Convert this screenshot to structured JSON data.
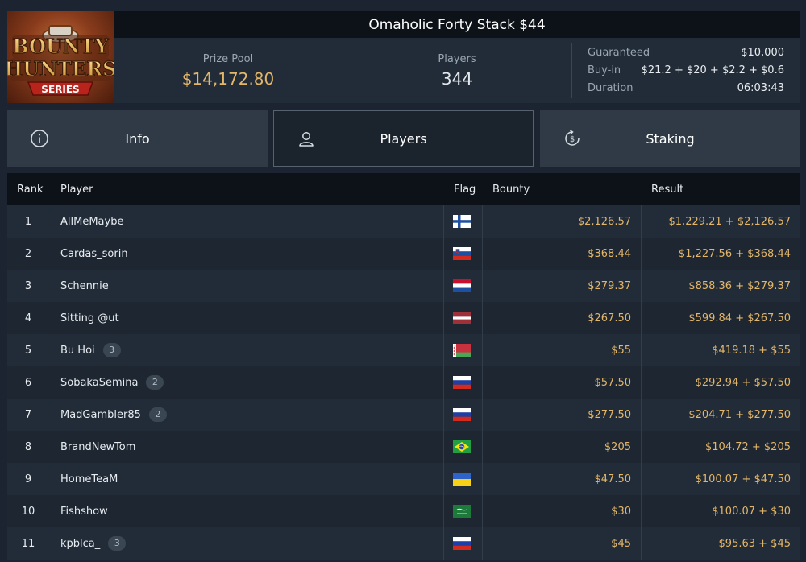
{
  "tournament": {
    "title": "Omaholic Forty Stack $44",
    "logo_text": "BOUNTY HUNTERS SERIES"
  },
  "summary": {
    "prize_pool_label": "Prize Pool",
    "prize_pool_value": "$14,172.80",
    "players_label": "Players",
    "players_value": "344",
    "details": [
      {
        "label": "Guaranteed",
        "value": "$10,000"
      },
      {
        "label": "Buy-in",
        "value": "$21.2 + $20 + $2.2 + $0.6"
      },
      {
        "label": "Duration",
        "value": "06:03:43"
      }
    ]
  },
  "tabs": [
    {
      "label": "Info",
      "icon": "info-icon"
    },
    {
      "label": "Players",
      "icon": "user-icon",
      "active": true
    },
    {
      "label": "Staking",
      "icon": "dollar-cycle-icon"
    }
  ],
  "table": {
    "headers": {
      "rank": "Rank",
      "player": "Player",
      "flag": "Flag",
      "bounty": "Bounty",
      "result": "Result"
    },
    "rows": [
      {
        "rank": "1",
        "player": "AllMeMaybe",
        "badge": "",
        "flag": "finland",
        "bounty": "$2,126.57",
        "result": "$1,229.21 + $2,126.57"
      },
      {
        "rank": "2",
        "player": "Cardas_sorin",
        "badge": "",
        "flag": "slovenia",
        "bounty": "$368.44",
        "result": "$1,227.56 + $368.44"
      },
      {
        "rank": "3",
        "player": "Schennie",
        "badge": "",
        "flag": "netherlands",
        "bounty": "$279.37",
        "result": "$858.36 + $279.37"
      },
      {
        "rank": "4",
        "player": "Sitting @ut",
        "badge": "",
        "flag": "latvia",
        "bounty": "$267.50",
        "result": "$599.84 + $267.50"
      },
      {
        "rank": "5",
        "player": "Bu Hoi",
        "badge": "3",
        "flag": "belarus",
        "bounty": "$55",
        "result": "$419.18 + $55"
      },
      {
        "rank": "6",
        "player": "SobakaSemina",
        "badge": "2",
        "flag": "russia",
        "bounty": "$57.50",
        "result": "$292.94 + $57.50"
      },
      {
        "rank": "7",
        "player": "MadGambler85",
        "badge": "2",
        "flag": "russia",
        "bounty": "$277.50",
        "result": "$204.71 + $277.50"
      },
      {
        "rank": "8",
        "player": "BrandNewTom",
        "badge": "",
        "flag": "brazil",
        "bounty": "$205",
        "result": "$104.72 + $205"
      },
      {
        "rank": "9",
        "player": "HomeTeaM",
        "badge": "",
        "flag": "ukraine",
        "bounty": "$47.50",
        "result": "$100.07 + $47.50"
      },
      {
        "rank": "10",
        "player": "Fishshow",
        "badge": "",
        "flag": "saudi-arabia",
        "bounty": "$30",
        "result": "$100.07 + $30"
      },
      {
        "rank": "11",
        "player": "kpblca_",
        "badge": "3",
        "flag": "russia",
        "bounty": "$45",
        "result": "$95.63 + $45"
      }
    ]
  },
  "colors": {
    "accent_gold": "#e3b66a",
    "background": "#1b2430",
    "header_bar": "#0d1218",
    "row_odd": "#222c38",
    "row_even": "#1d2631"
  }
}
